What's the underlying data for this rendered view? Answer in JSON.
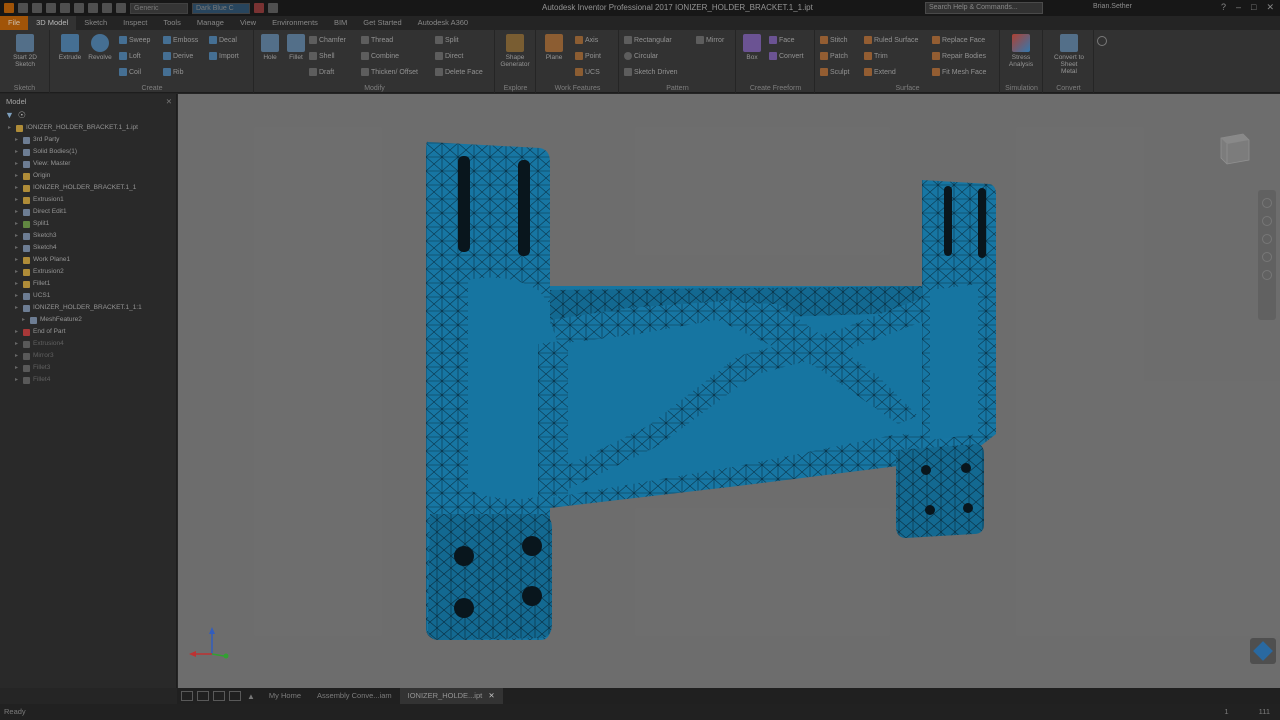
{
  "app": {
    "title": "Autodesk Inventor Professional 2017   IONIZER_HOLDER_BRACKET.1_1.ipt",
    "search_placeholder": "Search Help & Commands...",
    "user": "Brian.Sether",
    "quick_access_box1": "Generic",
    "quick_access_box2": "Dark Blue C"
  },
  "tabs": [
    "File",
    "3D Model",
    "Sketch",
    "Inspect",
    "Tools",
    "Manage",
    "View",
    "Environments",
    "BIM",
    "Get Started",
    "Autodesk A360"
  ],
  "ribbon": {
    "sketch": {
      "label": "Sketch",
      "start_sketch": "Start 2D Sketch"
    },
    "create": {
      "label": "Create",
      "extrude": "Extrude",
      "revolve": "Revolve",
      "small": [
        "Sweep",
        "Loft",
        "Coil",
        "Emboss",
        "Derive",
        "Rib",
        "Decal",
        "Import"
      ]
    },
    "modify": {
      "label": "Modify",
      "hole": "Hole",
      "fillet": "Fillet",
      "small": [
        "Chamfer",
        "Shell",
        "Draft",
        "Thread",
        "Combine",
        "Thicken/ Offset",
        "Split",
        "Direct",
        "Delete Face"
      ]
    },
    "explore": {
      "label": "Explore",
      "shape_generator": "Shape Generator"
    },
    "work_features": {
      "label": "Work Features",
      "plane": "Plane",
      "small": [
        "Axis",
        "Point",
        "UCS"
      ]
    },
    "pattern": {
      "label": "Pattern",
      "small": [
        "Rectangular",
        "Circular",
        "Sketch Driven",
        "Mirror"
      ]
    },
    "freeform": {
      "label": "Create Freeform",
      "box": "Box",
      "small": [
        "Face",
        "Convert"
      ]
    },
    "surface": {
      "label": "Surface",
      "small": [
        "Stitch",
        "Patch",
        "Sculpt",
        "Ruled Surface",
        "Trim",
        "Extend",
        "Replace Face",
        "Repair Bodies",
        "Fit Mesh Face"
      ]
    },
    "simulation": {
      "label": "Simulation",
      "stress": "Stress Analysis"
    },
    "convert": {
      "label": "Convert",
      "sheet_metal": "Convert to Sheet Metal"
    }
  },
  "browser": {
    "title": "Model",
    "items": [
      {
        "label": "IONIZER_HOLDER_BRACKET.1_1.ipt",
        "indent": 0,
        "dim": false,
        "color": "#c8a040"
      },
      {
        "label": "3rd Party",
        "indent": 1,
        "dim": false,
        "color": "#7d8fa8"
      },
      {
        "label": "Solid Bodies(1)",
        "indent": 1,
        "dim": false,
        "color": "#7d8fa8"
      },
      {
        "label": "View: Master",
        "indent": 1,
        "dim": false,
        "color": "#7d8fa8"
      },
      {
        "label": "Origin",
        "indent": 1,
        "dim": false,
        "color": "#c8a040"
      },
      {
        "label": "IONIZER_HOLDER_BRACKET.1_1",
        "indent": 1,
        "dim": false,
        "color": "#c8a040"
      },
      {
        "label": "Extrusion1",
        "indent": 1,
        "dim": false,
        "color": "#c8a040"
      },
      {
        "label": "Direct Edit1",
        "indent": 1,
        "dim": false,
        "color": "#7d8fa8"
      },
      {
        "label": "Split1",
        "indent": 1,
        "dim": false,
        "color": "#6f9a4a"
      },
      {
        "label": "Sketch3",
        "indent": 1,
        "dim": false,
        "color": "#7d8fa8"
      },
      {
        "label": "Sketch4",
        "indent": 1,
        "dim": false,
        "color": "#7d8fa8"
      },
      {
        "label": "Work Plane1",
        "indent": 1,
        "dim": false,
        "color": "#c8a040"
      },
      {
        "label": "Extrusion2",
        "indent": 1,
        "dim": false,
        "color": "#c8a040"
      },
      {
        "label": "Fillet1",
        "indent": 1,
        "dim": false,
        "color": "#c8a040"
      },
      {
        "label": "UCS1",
        "indent": 1,
        "dim": false,
        "color": "#7d8fa8"
      },
      {
        "label": "IONIZER_HOLDER_BRACKET.1_1:1",
        "indent": 1,
        "dim": false,
        "color": "#7d8fa8"
      },
      {
        "label": "MeshFeature2",
        "indent": 2,
        "dim": false,
        "color": "#7d8fa8"
      },
      {
        "label": "End of Part",
        "indent": 1,
        "dim": false,
        "color": "#c04040"
      },
      {
        "label": "Extrusion4",
        "indent": 1,
        "dim": true,
        "color": "#666666"
      },
      {
        "label": "Mirror3",
        "indent": 1,
        "dim": true,
        "color": "#666666"
      },
      {
        "label": "Fillet3",
        "indent": 1,
        "dim": true,
        "color": "#666666"
      },
      {
        "label": "Fillet4",
        "indent": 1,
        "dim": true,
        "color": "#666666"
      }
    ]
  },
  "doc_tabs": [
    {
      "label": "My Home",
      "active": false
    },
    {
      "label": "Assembly Conve...iam",
      "active": false
    },
    {
      "label": "IONIZER_HOLDE...ipt",
      "active": true
    }
  ],
  "status": {
    "left": "Ready",
    "right1": "1",
    "right2": "111"
  },
  "colors": {
    "part_blue": "#1a86b8",
    "accent_file": "#b8600a"
  }
}
